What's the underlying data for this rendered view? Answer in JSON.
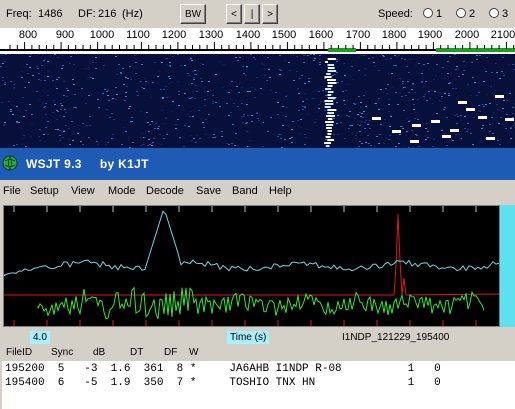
{
  "toolbar": {
    "freq_label": "Freq:",
    "freq_value": "1486",
    "df_label": "DF:",
    "df_value": "216",
    "df_unit": "(Hz)",
    "bw_label": "BW",
    "btn_left": "<",
    "btn_center": "|",
    "btn_right": ">",
    "speed_label": "Speed:",
    "speed_options": [
      "1",
      "2",
      "3"
    ]
  },
  "ruler": {
    "ticks": [
      "800",
      "900",
      "1000",
      "1100",
      "1200",
      "1300",
      "1400",
      "1500",
      "1600",
      "1700",
      "1800",
      "1900",
      "2000",
      "2100"
    ]
  },
  "window": {
    "title": "WSJT 9.3     by K1JT"
  },
  "menu": {
    "items": [
      "File",
      "Setup",
      "View",
      "Mode",
      "Decode",
      "Save",
      "Band",
      "Help"
    ]
  },
  "plot_status": {
    "left_value": "4.0",
    "axis_label": "Time (s)",
    "filename": "I1NDP_121229_195400"
  },
  "decode_header": {
    "columns": [
      "FileID",
      "Sync",
      "dB",
      "DT",
      "DF",
      "W"
    ]
  },
  "decodes": {
    "rows": [
      "195200  5   -3  1.6  361  8 *     JA6AHB I1NDP R-08          1   0",
      "195400  6   -5  1.9  350  7 *     TOSHIO TNX HN              1   0"
    ]
  },
  "colors": {
    "titlebar": "#1e5bb4",
    "plot_bg": "#000000",
    "trace_cyan": "#6fd3e8",
    "trace_green": "#33e633",
    "trace_red": "#e01818",
    "highlight_cyan": "#a8f0ff"
  }
}
